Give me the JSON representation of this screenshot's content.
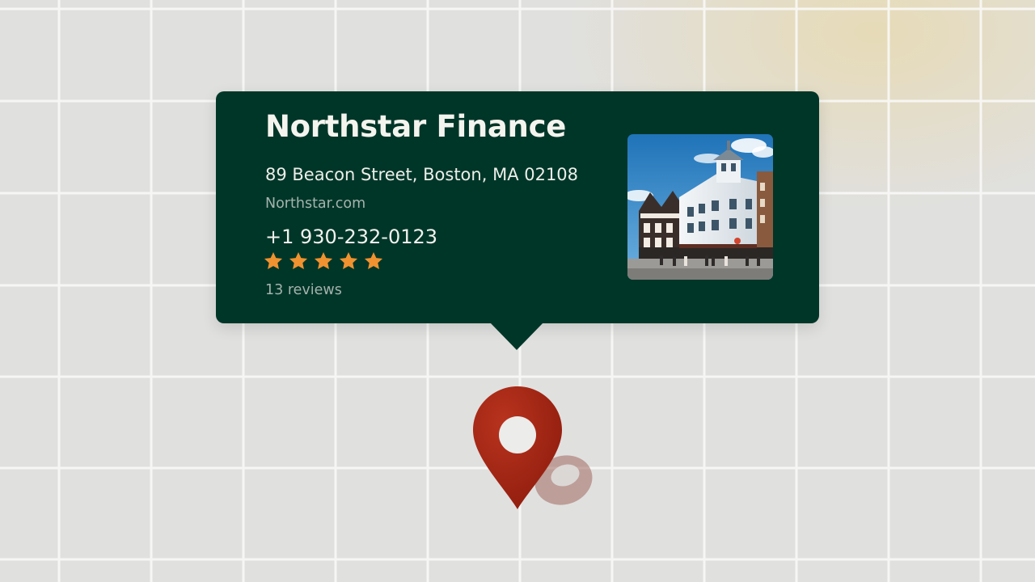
{
  "business": {
    "name": "Northstar Finance",
    "address": "89 Beacon Street, Boston, MA 02108",
    "website": "Northstar.com",
    "phone": "+1 930-232-0123",
    "rating": 5,
    "rating_max": 5,
    "reviews_label": "13 reviews",
    "photo_icon": "storefront-building-photo"
  },
  "marker": {
    "icon": "map-pin-icon",
    "color": "#9b1f10"
  },
  "colors": {
    "card_background": "#003628",
    "star": "#f0922f",
    "map_background": "#e0e0df",
    "grid_line": "#ffffff"
  }
}
